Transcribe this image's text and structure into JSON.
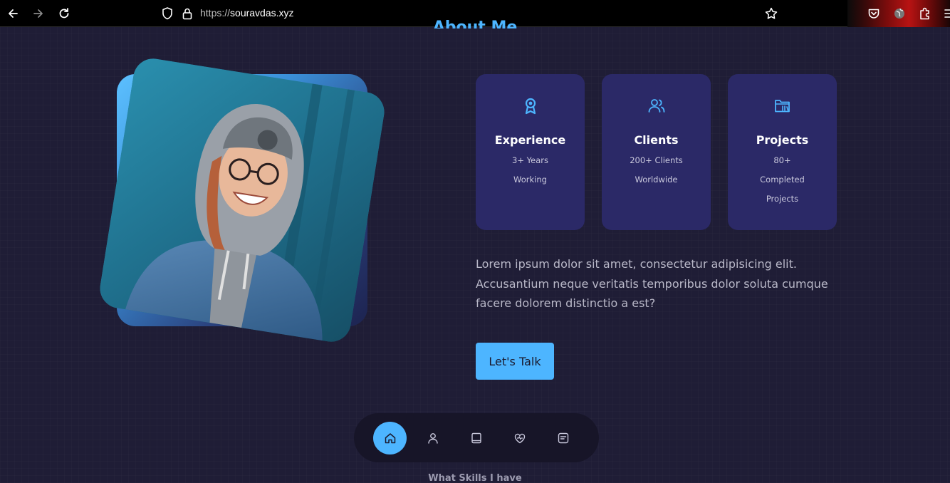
{
  "browser": {
    "url_scheme": "https://",
    "url_host": "souravdas.xyz",
    "icons": [
      "back-arrow-icon",
      "forward-arrow-icon",
      "reload-icon",
      "shield-icon",
      "lock-icon",
      "star-icon",
      "pocket-icon",
      "globe-icon",
      "extensions-icon",
      "menu-icon"
    ]
  },
  "section": {
    "heading": "About Me"
  },
  "cards": [
    {
      "icon": "award-icon",
      "title": "Experience",
      "lines": [
        "3+ Years",
        "Working"
      ]
    },
    {
      "icon": "users-icon",
      "title": "Clients",
      "lines": [
        "200+ Clients",
        "Worldwide"
      ]
    },
    {
      "icon": "folder-icon",
      "title": "Projects",
      "lines": [
        "80+",
        "Completed",
        "Projects"
      ]
    }
  ],
  "about_text": "Lorem ipsum dolor sit amet, consectetur adipisicing elit. Accusantium neque veritatis temporibus dolor soluta cumque facere dolorem distinctio a est?",
  "cta": {
    "label": "Let's Talk"
  },
  "bottom_nav": {
    "items": [
      {
        "name": "home",
        "icon": "home-icon",
        "active": true
      },
      {
        "name": "about",
        "icon": "user-icon",
        "active": false
      },
      {
        "name": "experience",
        "icon": "book-icon",
        "active": false
      },
      {
        "name": "services",
        "icon": "heart-icon",
        "active": false
      },
      {
        "name": "contact",
        "icon": "message-icon",
        "active": false
      }
    ]
  },
  "next_section": {
    "heading": "What Skills I have"
  },
  "colors": {
    "accent": "#4db5ff",
    "card_bg": "#2b2967",
    "page_bg": "#1f1d36",
    "nav_bg": "#171528"
  }
}
